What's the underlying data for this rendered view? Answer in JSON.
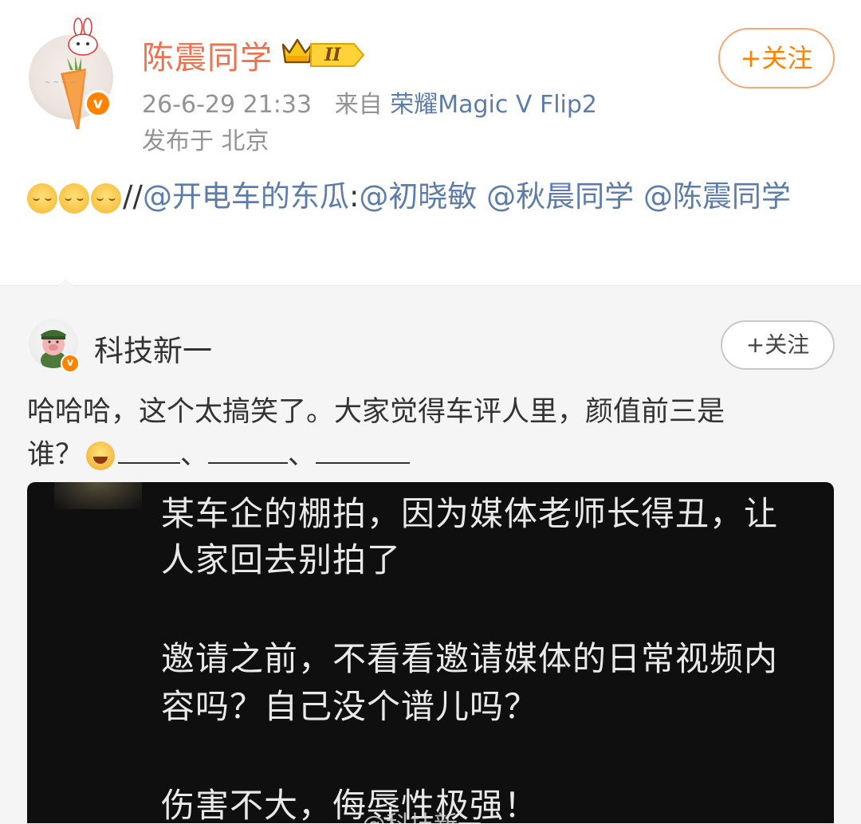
{
  "post": {
    "author": "陈震同学",
    "level": "II",
    "timestamp": "26-6-29 21:33",
    "from_label": "来自",
    "device": "荣耀Magic V Flip2",
    "location": "发布于 北京",
    "follow_label": "+关注",
    "emojis": [
      "smile-icon",
      "smile-icon",
      "smile-icon"
    ],
    "text_prefix": "//",
    "text_mention1": "@开电车的东瓜",
    "text_colon": ":",
    "text_mention2": "@初晓敏",
    "text_mention3": "@秋晨同学",
    "text_mention4": "@陈震同学"
  },
  "repost": {
    "author": "科技新一",
    "follow_label": "+关注",
    "text_line1": "哈哈哈，这个太搞笑了。大家觉得车评人里，颜值前三是",
    "text_line2_start": "谁？",
    "text_sep": "、",
    "image": {
      "line1": "某车企的棚拍，因为媒体老师长得丑，让",
      "line2": "人家回去别拍了",
      "line3": "邀请之前，不看看邀请媒体的日常视频内",
      "line4": "容吗？自己没个谱儿吗？",
      "line5": "伤害不大，侮辱性极强！",
      "watermark": "@科技新一"
    }
  },
  "colors": {
    "name": "#eb7350",
    "link": "#5d7caa",
    "follow": "#ff8200",
    "meta": "#939393"
  }
}
